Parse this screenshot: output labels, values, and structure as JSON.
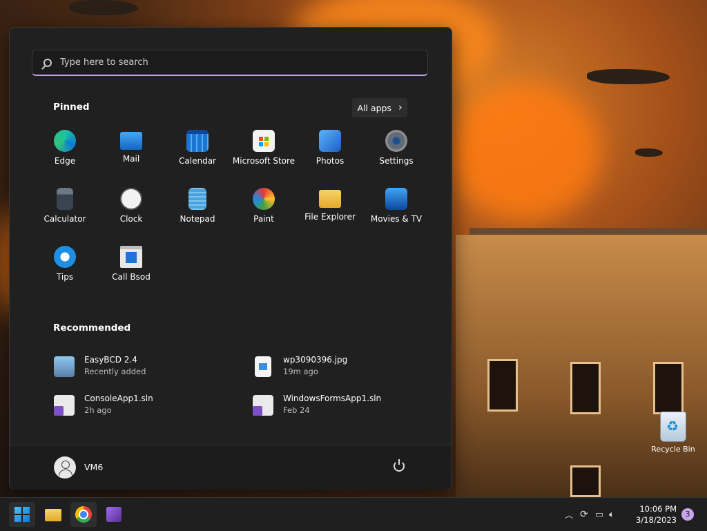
{
  "search": {
    "placeholder": "Type here to search"
  },
  "pinned": {
    "title": "Pinned",
    "all_apps_label": "All apps",
    "apps": [
      {
        "label": "Edge",
        "icon": "edge-icon",
        "color": "#1aa36b"
      },
      {
        "label": "Mail",
        "icon": "mail-icon",
        "color": "#1e88e5"
      },
      {
        "label": "Calendar",
        "icon": "calendar-icon",
        "color": "#1976d2"
      },
      {
        "label": "Microsoft Store",
        "icon": "store-icon",
        "color": "#f3f3f3"
      },
      {
        "label": "Photos",
        "icon": "photos-icon",
        "color": "#2e7bd6"
      },
      {
        "label": "Settings",
        "icon": "gear-icon",
        "color": "#8c8c8c"
      },
      {
        "label": "Calculator",
        "icon": "calculator-icon",
        "color": "#5f6b78"
      },
      {
        "label": "Clock",
        "icon": "clock-icon",
        "color": "#e0e0e0"
      },
      {
        "label": "Notepad",
        "icon": "notepad-icon",
        "color": "#4aa3df"
      },
      {
        "label": "Paint",
        "icon": "paint-icon",
        "color": "#3aa0e6"
      },
      {
        "label": "File Explorer",
        "icon": "folder-icon",
        "color": "#f2c14e"
      },
      {
        "label": "Movies & TV",
        "icon": "movies-icon",
        "color": "#1f73d6"
      },
      {
        "label": "Tips",
        "icon": "lightbulb-icon",
        "color": "#1f8fe6"
      },
      {
        "label": "Call Bsod",
        "icon": "app-window-icon",
        "color": "#2a7fd4"
      }
    ]
  },
  "recommended": {
    "title": "Recommended",
    "items": [
      {
        "name": "EasyBCD 2.4",
        "sub": "Recently added",
        "icon": "easybcd-icon"
      },
      {
        "name": "wp3090396.jpg",
        "sub": "19m ago",
        "icon": "image-file-icon"
      },
      {
        "name": "ConsoleApp1.sln",
        "sub": "2h ago",
        "icon": "visual-studio-solution-icon"
      },
      {
        "name": "WindowsFormsApp1.sln",
        "sub": "Feb 24",
        "icon": "visual-studio-solution-icon"
      }
    ]
  },
  "user": {
    "name": "VM6"
  },
  "desktop": {
    "recycle_bin": "Recycle Bin"
  },
  "taskbar": {
    "time": "10:06 PM",
    "date": "3/18/2023",
    "notifications": "3"
  },
  "colors": {
    "accent": "#c3a0e6",
    "menu_bg": "#202020",
    "taskbar_bg": "#1f1f1f"
  }
}
